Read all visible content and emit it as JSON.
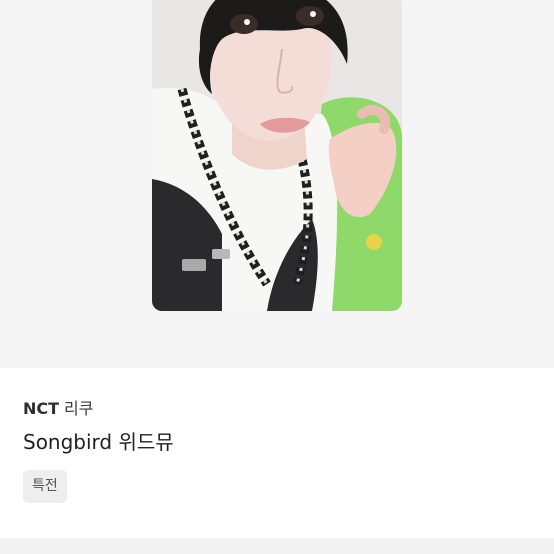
{
  "product": {
    "artist": "NCT",
    "member": "리쿠",
    "title": "Songbird 위드뮤",
    "tag": "특전"
  },
  "image": {
    "subject": "photocard-selfie"
  },
  "colors": {
    "image_background": "#f5f5f5",
    "tag_background": "#eeeeee",
    "text_primary": "#222222"
  }
}
